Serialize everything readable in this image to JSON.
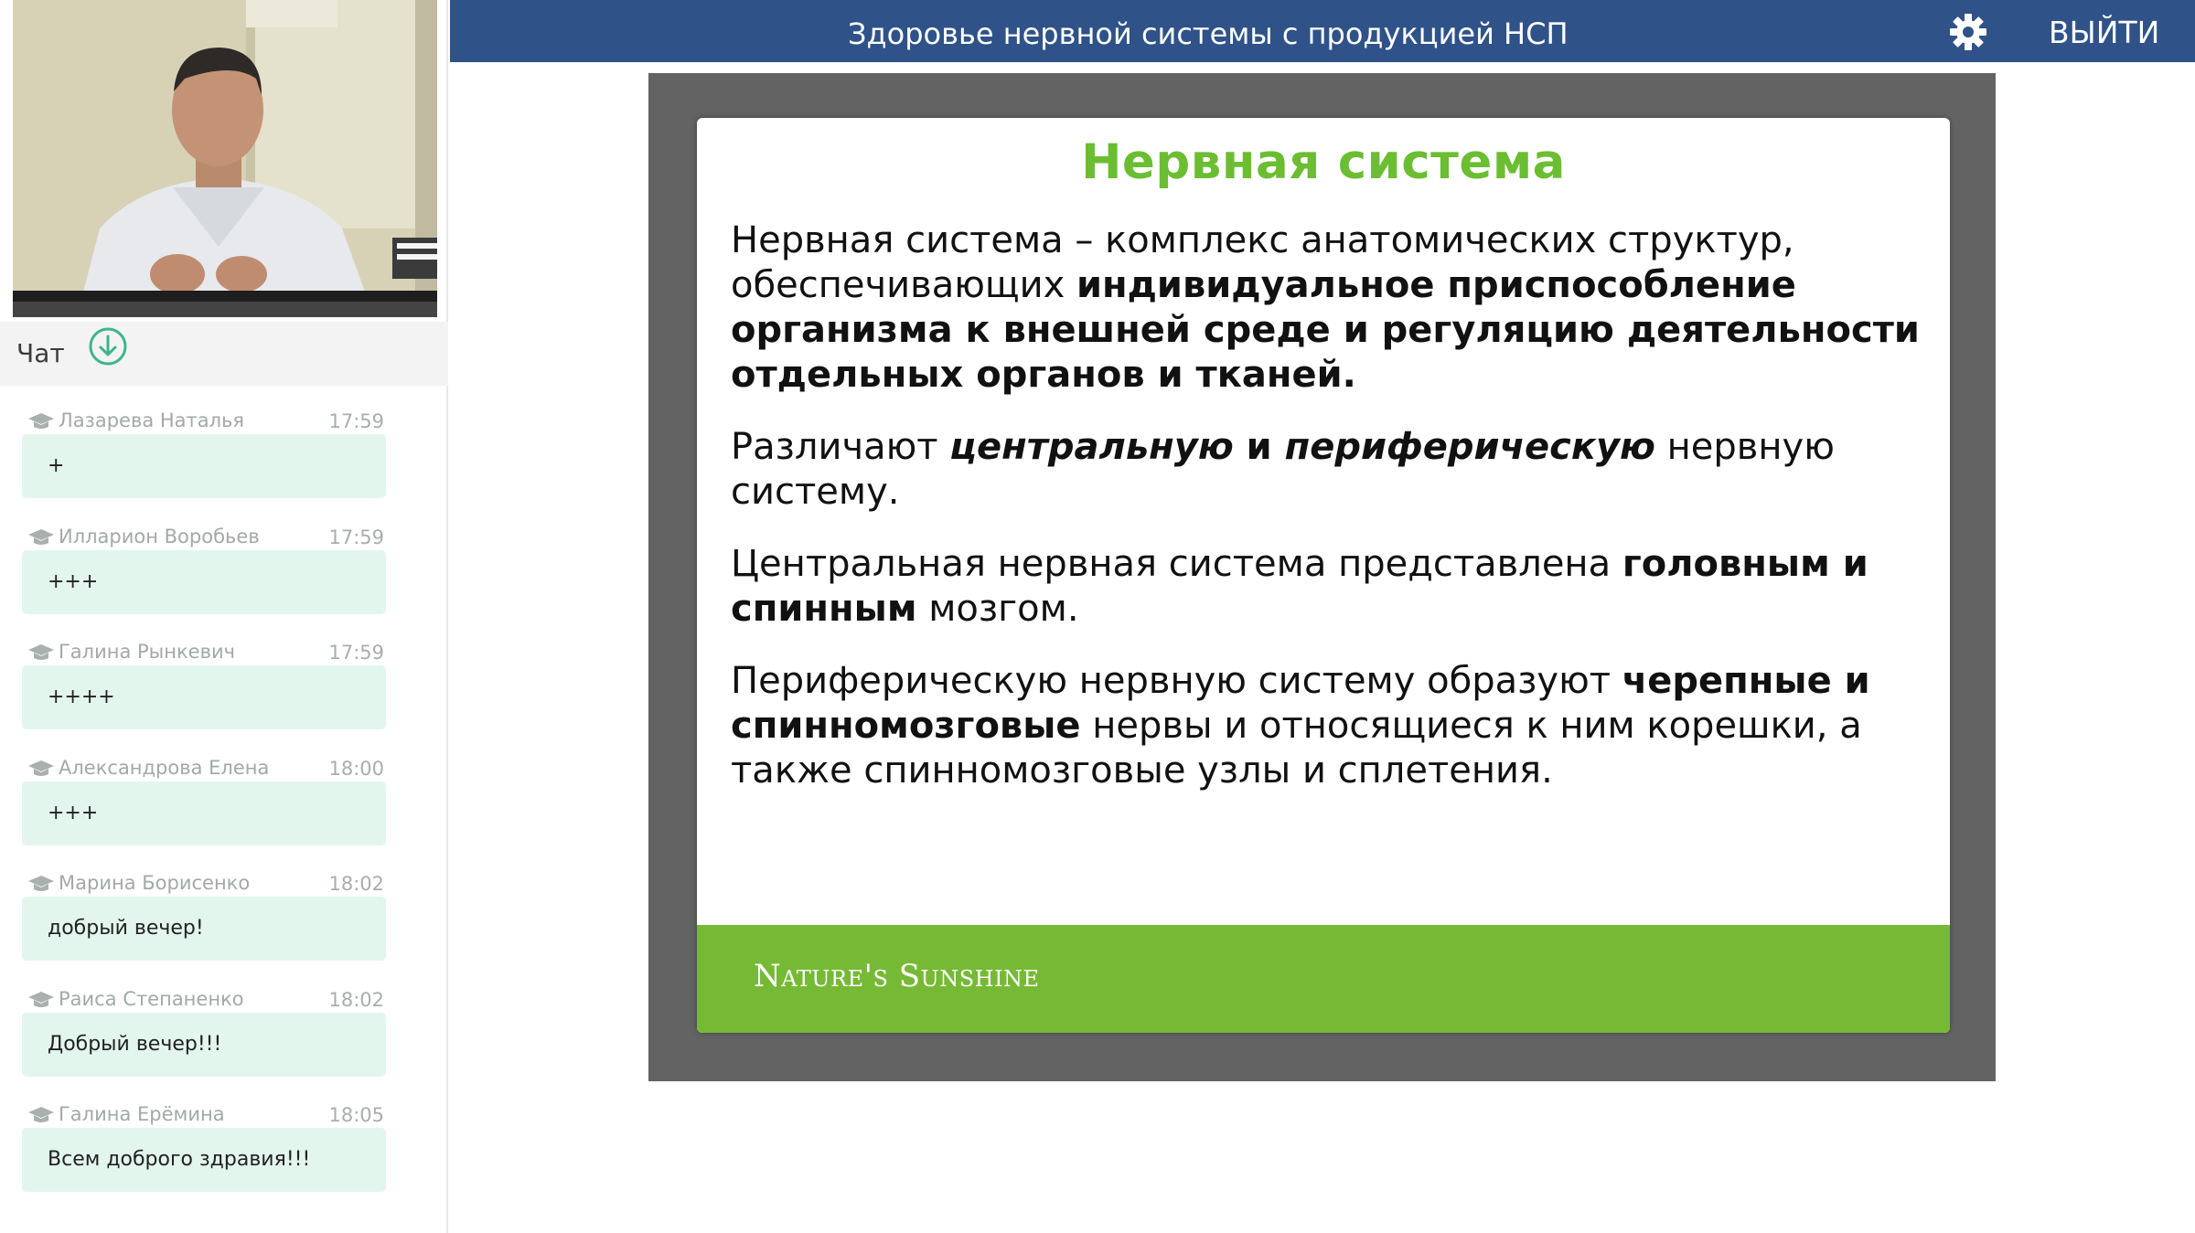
{
  "header": {
    "title": "Здоровье нервной системы с продукцией НСП",
    "logout_label": "ВЫЙТИ",
    "bar_color": "#2f5288"
  },
  "chat": {
    "title": "Чат",
    "messages": [
      {
        "author": "Лазарева Наталья",
        "time": "17:59",
        "text": "+"
      },
      {
        "author": "Илларион Воробьев",
        "time": "17:59",
        "text": "+++"
      },
      {
        "author": "Галина Рынкевич",
        "time": "17:59",
        "text": "++++"
      },
      {
        "author": "Александрова Елена",
        "time": "18:00",
        "text": "+++"
      },
      {
        "author": "Марина Борисенко",
        "time": "18:02",
        "text": "добрый вечер!"
      },
      {
        "author": "Раиса Степаненко",
        "time": "18:02",
        "text": "Добрый вечер!!!"
      },
      {
        "author": "Галина Ерёмина",
        "time": "18:05",
        "text": "Всем доброго здравия!!!"
      }
    ],
    "bubble_color": "#e2f6ee",
    "accent_color": "#3db58a"
  },
  "slide": {
    "title": "Нервная система",
    "p1_a": "Нервная система – комплекс анатомических структур, обеспечивающих ",
    "p1_b": "индивидуальное приспособление организма к внешней среде и регуляцию деятельности отдельных органов и тканей.",
    "p2_a": "Различают ",
    "p2_b": "центральную",
    "p2_c": " и ",
    "p2_d": "периферическую",
    "p2_e": " нервную систему.",
    "p3_a": "Центральная нервная система представлена ",
    "p3_b": "головным и спинным",
    "p3_c": " мозгом.",
    "p4_a": "Периферическую нервную систему образуют ",
    "p4_b": "черепные и спинномозговые",
    "p4_c": " нервы и относящиеся к ним корешки, а также спинномозговые узлы и сплетения.",
    "footer_logo": "Nature's Sunshine",
    "title_color": "#6bbd32",
    "footer_color": "#76b935"
  }
}
